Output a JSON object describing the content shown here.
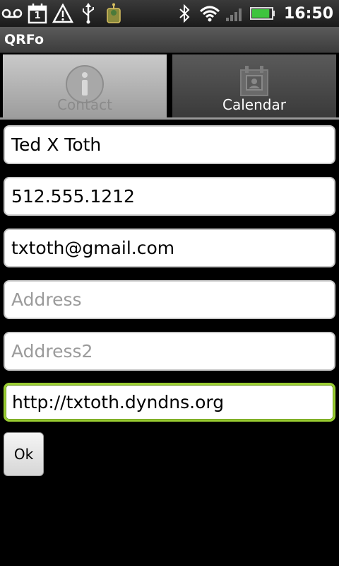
{
  "status_bar": {
    "clock": "16:50",
    "calendar_day": "1",
    "icons": [
      "voicemail-icon",
      "calendar-icon",
      "warning-icon",
      "usb-icon",
      "android-icon",
      "bluetooth-icon",
      "wifi-icon",
      "signal-icon",
      "battery-icon"
    ],
    "battery_level": 0.9
  },
  "app": {
    "title": "QRFo"
  },
  "tabs": [
    {
      "label": "Contact",
      "icon": "info-icon",
      "selected": true
    },
    {
      "label": "Calendar",
      "icon": "calendar-icon",
      "selected": false
    }
  ],
  "form": {
    "name": {
      "value": "Ted X Toth",
      "placeholder": ""
    },
    "phone": {
      "value": "512.555.1212",
      "placeholder": ""
    },
    "email": {
      "value": "txtoth@gmail.com",
      "placeholder": ""
    },
    "address": {
      "value": "",
      "placeholder": "Address"
    },
    "address2": {
      "value": "",
      "placeholder": "Address2"
    },
    "url": {
      "value": "http://txtoth.dyndns.org",
      "placeholder": ""
    },
    "ok_label": "Ok"
  },
  "colors": {
    "background": "#000000",
    "focus_border": "#9acd32",
    "battery": "#3ec43e"
  }
}
